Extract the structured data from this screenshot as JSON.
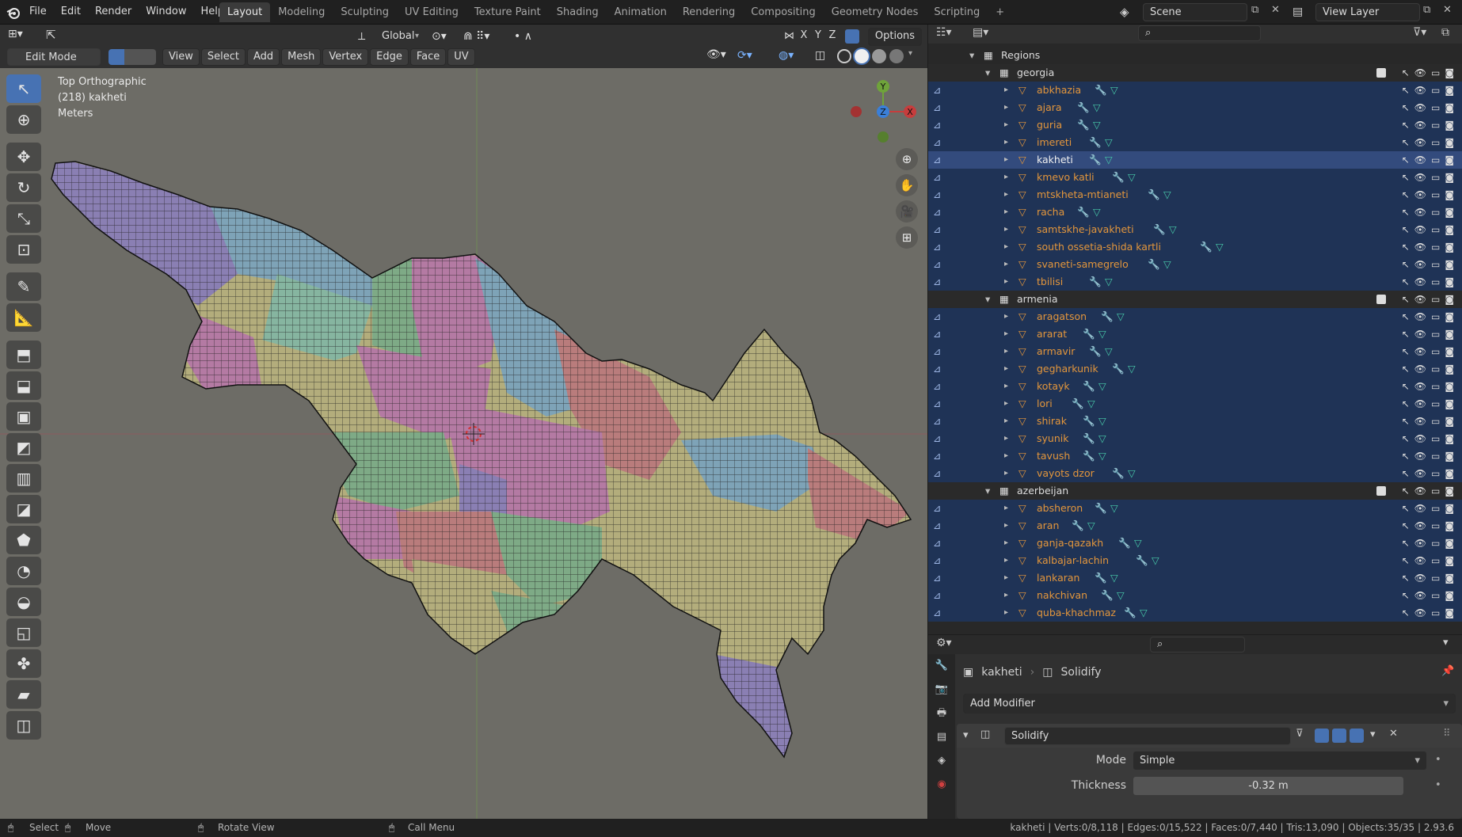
{
  "app": {
    "logo": "blender-icon"
  },
  "menu": [
    "File",
    "Edit",
    "Render",
    "Window",
    "Help"
  ],
  "workspaces": [
    "Layout",
    "Modeling",
    "Sculpting",
    "UV Editing",
    "Texture Paint",
    "Shading",
    "Animation",
    "Rendering",
    "Compositing",
    "Geometry Nodes",
    "Scripting"
  ],
  "active_workspace": "Layout",
  "scene": {
    "label": "Scene",
    "view_layer": "View Layer"
  },
  "viewport_header": {
    "orientation": "Global",
    "options": "Options",
    "mode": "Edit Mode",
    "menus": [
      "View",
      "Select",
      "Add",
      "Mesh",
      "Vertex",
      "Edge",
      "Face",
      "UV"
    ],
    "axes": [
      "X",
      "Y",
      "Z"
    ]
  },
  "viewport_info": {
    "view": "Top Orthographic",
    "object": "(218) kakheti",
    "units": "Meters"
  },
  "gizmo": {
    "x": "X",
    "y": "Y",
    "z": "Z"
  },
  "outliner": {
    "root": "Regions",
    "collections": [
      {
        "name": "georgia",
        "items": [
          "abkhazia",
          "ajara",
          "guria",
          "imereti",
          "kakheti",
          "kmevo katli",
          "mtskheta-mtianeti",
          "racha",
          "samtskhe-javakheti",
          "south ossetia-shida kartli",
          "svaneti-samegrelo",
          "tbilisi"
        ]
      },
      {
        "name": "armenia",
        "items": [
          "aragatson",
          "ararat",
          "armavir",
          "gegharkunik",
          "kotayk",
          "lori",
          "shirak",
          "syunik",
          "tavush",
          "vayots dzor"
        ]
      },
      {
        "name": "azerbeijan",
        "items": [
          "absheron",
          "aran",
          "ganja-qazakh",
          "kalbajar-lachin",
          "lankaran",
          "nakchivan",
          "quba-khachmaz"
        ]
      }
    ],
    "selected": "kakheti",
    "colors": {
      "child_bg": "#1f3356",
      "selected_bg": "#334b7d",
      "name": "#e3963c",
      "modifier": "#9fb7e6",
      "mesh_data": "#47c8a8"
    }
  },
  "properties": {
    "breadcrumb_object": "kakheti",
    "breadcrumb_modifier": "Solidify",
    "add_modifier": "Add Modifier",
    "modifier_name": "Solidify",
    "mode_label": "Mode",
    "mode_value": "Simple",
    "thickness_label": "Thickness",
    "thickness_value": "-0.32 m"
  },
  "status_bar": {
    "select": "Select",
    "move": "Move",
    "rotate": "Rotate View",
    "call_menu": "Call Menu",
    "stats": "kakheti | Verts:0/8,118 | Edges:0/15,522 | Faces:0/7,440 | Tris:13,090 | Objects:35/35 | 2.93.6"
  },
  "map_colors": {
    "purple": "#8a7fb3",
    "blue": "#7ea3b7",
    "pink": "#b47aa3",
    "green": "#7eaa86",
    "yellow": "#b3ad7c",
    "salmon": "#b97c7c",
    "mint": "#86b5a0"
  }
}
